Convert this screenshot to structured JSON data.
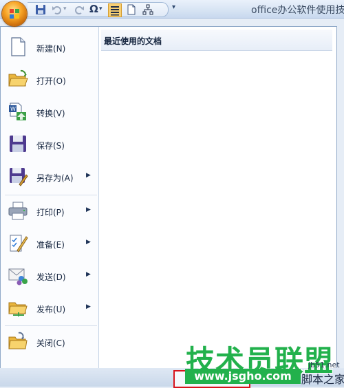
{
  "app": {
    "title": "office办公软件使用技"
  },
  "quick_access": {
    "buttons": [
      {
        "icon": "save-icon"
      },
      {
        "icon": "undo-icon"
      },
      {
        "icon": "redo-icon"
      },
      {
        "icon": "omega-symbol-icon",
        "label": "Ω"
      },
      {
        "icon": "align-text-icon"
      },
      {
        "icon": "new-page-icon"
      },
      {
        "icon": "org-chart-icon"
      }
    ],
    "more": "▾"
  },
  "menu": {
    "items": [
      {
        "label": "新建(N)",
        "icon": "new-document-icon",
        "has_submenu": false
      },
      {
        "label": "打开(O)",
        "icon": "open-folder-icon",
        "has_submenu": false
      },
      {
        "label": "转换(V)",
        "icon": "convert-icon",
        "has_submenu": false
      },
      {
        "label": "保存(S)",
        "icon": "save-disk-icon",
        "has_submenu": false
      },
      {
        "label": "另存为(A)",
        "icon": "save-as-icon",
        "has_submenu": true
      },
      {
        "label": "打印(P)",
        "icon": "printer-icon",
        "has_submenu": true
      },
      {
        "label": "准备(E)",
        "icon": "prepare-icon",
        "has_submenu": true
      },
      {
        "label": "发送(D)",
        "icon": "send-icon",
        "has_submenu": true
      },
      {
        "label": "发布(U)",
        "icon": "publish-icon",
        "has_submenu": true
      },
      {
        "label": "关闭(C)",
        "icon": "close-folder-icon",
        "has_submenu": false
      }
    ],
    "submenu_arrow": "▶",
    "recent_header": "最近使用的文档"
  },
  "watermark": {
    "main": "技术员联盟",
    "url": "www.jsgho.com",
    "site": "jb51.net",
    "home": "脚本之家"
  },
  "colors": {
    "accent_orange": "#f7a325",
    "watermark_green": "#22b14c",
    "highlight_red": "#d8131b"
  }
}
